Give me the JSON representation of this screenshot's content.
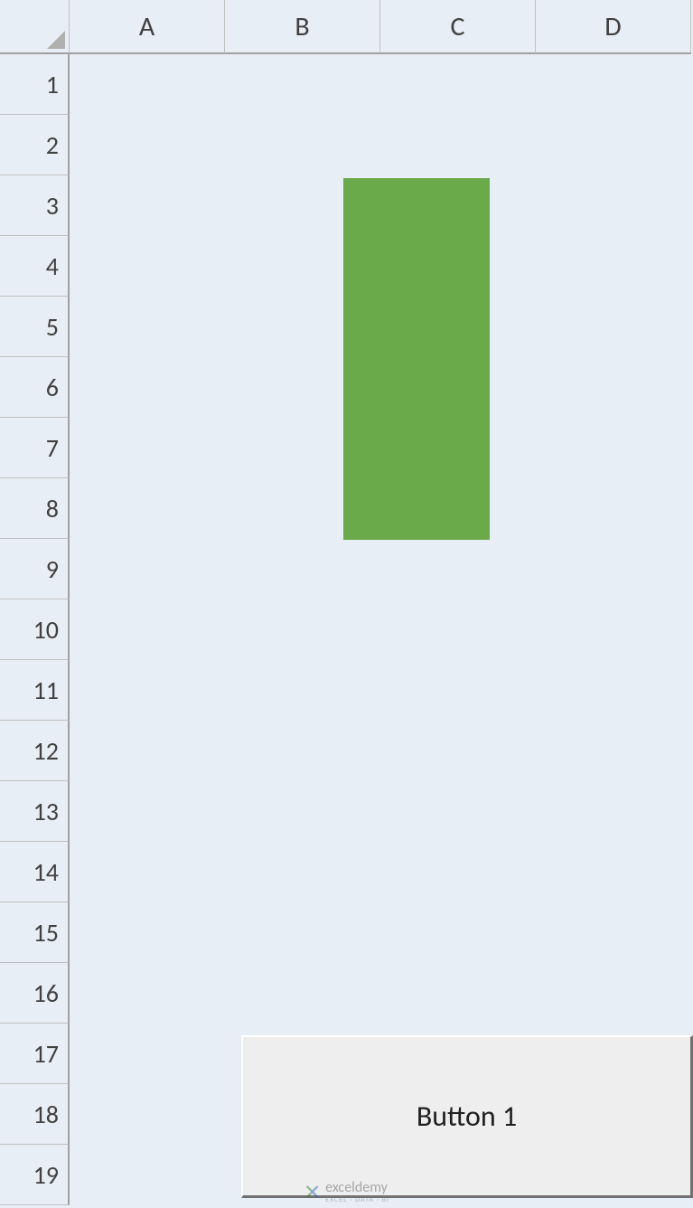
{
  "columns": [
    "A",
    "B",
    "C",
    "D"
  ],
  "rows": [
    "1",
    "2",
    "3",
    "4",
    "5",
    "6",
    "7",
    "8",
    "9",
    "10",
    "11",
    "12",
    "13",
    "14",
    "15",
    "16",
    "17",
    "18",
    "19"
  ],
  "shape": {
    "fill_color": "#6aaa4a"
  },
  "button": {
    "label": "Button 1"
  },
  "watermark": {
    "brand": "exceldemy",
    "tagline": "EXCEL · DATA · BI"
  }
}
